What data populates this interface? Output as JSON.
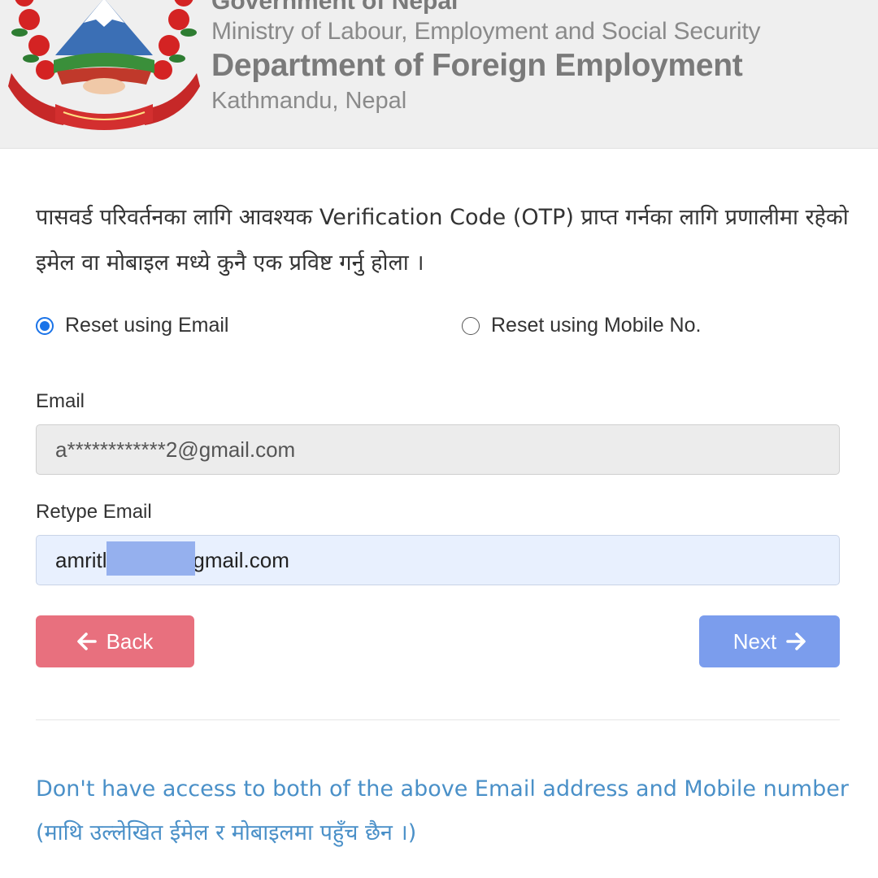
{
  "header": {
    "government": "Government of Nepal",
    "ministry": "Ministry of Labour, Employment and Social Security",
    "department": "Department of Foreign Employment",
    "city": "Kathmandu, Nepal",
    "emblem_icon": "nepal-emblem-icon"
  },
  "form": {
    "instructions": "पासवर्ड परिवर्तनका लागि आवश्यक Verification Code (OTP) प्राप्त गर्नका लागि प्रणालीमा रहेको इमेल वा मोबाइल मध्ये कुनै एक प्रविष्ट गर्नु होला ।",
    "options": [
      {
        "label": "Reset using Email",
        "selected": true
      },
      {
        "label": "Reset using Mobile No.",
        "selected": false
      }
    ],
    "email_label": "Email",
    "email_value": "a************2@gmail.com",
    "retype_label": "Retype Email",
    "retype_value": "amritl           @gmail.com",
    "back_label": "Back",
    "next_label": "Next"
  },
  "help": {
    "link_text": "Don't have access to both of the above Email address and Mobile number (माथि उल्लेखित ईमेल र मोबाइलमा पहुँच छैन ।)"
  },
  "colors": {
    "header_bg": "#efefef",
    "radio_accent": "#1a73e8",
    "back_button": "#e8707e",
    "next_button": "#7b9ded",
    "link": "#4a90c8"
  }
}
